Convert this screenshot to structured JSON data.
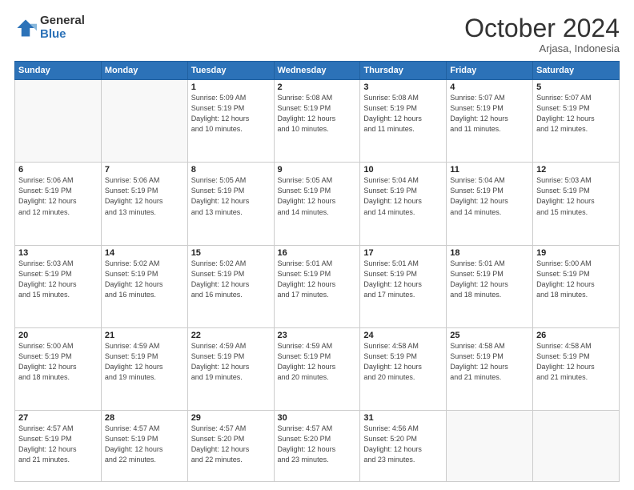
{
  "logo": {
    "general": "General",
    "blue": "Blue"
  },
  "title": "October 2024",
  "subtitle": "Arjasa, Indonesia",
  "days_of_week": [
    "Sunday",
    "Monday",
    "Tuesday",
    "Wednesday",
    "Thursday",
    "Friday",
    "Saturday"
  ],
  "weeks": [
    [
      {
        "day": "",
        "info": ""
      },
      {
        "day": "",
        "info": ""
      },
      {
        "day": "1",
        "info": "Sunrise: 5:09 AM\nSunset: 5:19 PM\nDaylight: 12 hours\nand 10 minutes."
      },
      {
        "day": "2",
        "info": "Sunrise: 5:08 AM\nSunset: 5:19 PM\nDaylight: 12 hours\nand 10 minutes."
      },
      {
        "day": "3",
        "info": "Sunrise: 5:08 AM\nSunset: 5:19 PM\nDaylight: 12 hours\nand 11 minutes."
      },
      {
        "day": "4",
        "info": "Sunrise: 5:07 AM\nSunset: 5:19 PM\nDaylight: 12 hours\nand 11 minutes."
      },
      {
        "day": "5",
        "info": "Sunrise: 5:07 AM\nSunset: 5:19 PM\nDaylight: 12 hours\nand 12 minutes."
      }
    ],
    [
      {
        "day": "6",
        "info": "Sunrise: 5:06 AM\nSunset: 5:19 PM\nDaylight: 12 hours\nand 12 minutes."
      },
      {
        "day": "7",
        "info": "Sunrise: 5:06 AM\nSunset: 5:19 PM\nDaylight: 12 hours\nand 13 minutes."
      },
      {
        "day": "8",
        "info": "Sunrise: 5:05 AM\nSunset: 5:19 PM\nDaylight: 12 hours\nand 13 minutes."
      },
      {
        "day": "9",
        "info": "Sunrise: 5:05 AM\nSunset: 5:19 PM\nDaylight: 12 hours\nand 14 minutes."
      },
      {
        "day": "10",
        "info": "Sunrise: 5:04 AM\nSunset: 5:19 PM\nDaylight: 12 hours\nand 14 minutes."
      },
      {
        "day": "11",
        "info": "Sunrise: 5:04 AM\nSunset: 5:19 PM\nDaylight: 12 hours\nand 14 minutes."
      },
      {
        "day": "12",
        "info": "Sunrise: 5:03 AM\nSunset: 5:19 PM\nDaylight: 12 hours\nand 15 minutes."
      }
    ],
    [
      {
        "day": "13",
        "info": "Sunrise: 5:03 AM\nSunset: 5:19 PM\nDaylight: 12 hours\nand 15 minutes."
      },
      {
        "day": "14",
        "info": "Sunrise: 5:02 AM\nSunset: 5:19 PM\nDaylight: 12 hours\nand 16 minutes."
      },
      {
        "day": "15",
        "info": "Sunrise: 5:02 AM\nSunset: 5:19 PM\nDaylight: 12 hours\nand 16 minutes."
      },
      {
        "day": "16",
        "info": "Sunrise: 5:01 AM\nSunset: 5:19 PM\nDaylight: 12 hours\nand 17 minutes."
      },
      {
        "day": "17",
        "info": "Sunrise: 5:01 AM\nSunset: 5:19 PM\nDaylight: 12 hours\nand 17 minutes."
      },
      {
        "day": "18",
        "info": "Sunrise: 5:01 AM\nSunset: 5:19 PM\nDaylight: 12 hours\nand 18 minutes."
      },
      {
        "day": "19",
        "info": "Sunrise: 5:00 AM\nSunset: 5:19 PM\nDaylight: 12 hours\nand 18 minutes."
      }
    ],
    [
      {
        "day": "20",
        "info": "Sunrise: 5:00 AM\nSunset: 5:19 PM\nDaylight: 12 hours\nand 18 minutes."
      },
      {
        "day": "21",
        "info": "Sunrise: 4:59 AM\nSunset: 5:19 PM\nDaylight: 12 hours\nand 19 minutes."
      },
      {
        "day": "22",
        "info": "Sunrise: 4:59 AM\nSunset: 5:19 PM\nDaylight: 12 hours\nand 19 minutes."
      },
      {
        "day": "23",
        "info": "Sunrise: 4:59 AM\nSunset: 5:19 PM\nDaylight: 12 hours\nand 20 minutes."
      },
      {
        "day": "24",
        "info": "Sunrise: 4:58 AM\nSunset: 5:19 PM\nDaylight: 12 hours\nand 20 minutes."
      },
      {
        "day": "25",
        "info": "Sunrise: 4:58 AM\nSunset: 5:19 PM\nDaylight: 12 hours\nand 21 minutes."
      },
      {
        "day": "26",
        "info": "Sunrise: 4:58 AM\nSunset: 5:19 PM\nDaylight: 12 hours\nand 21 minutes."
      }
    ],
    [
      {
        "day": "27",
        "info": "Sunrise: 4:57 AM\nSunset: 5:19 PM\nDaylight: 12 hours\nand 21 minutes."
      },
      {
        "day": "28",
        "info": "Sunrise: 4:57 AM\nSunset: 5:19 PM\nDaylight: 12 hours\nand 22 minutes."
      },
      {
        "day": "29",
        "info": "Sunrise: 4:57 AM\nSunset: 5:20 PM\nDaylight: 12 hours\nand 22 minutes."
      },
      {
        "day": "30",
        "info": "Sunrise: 4:57 AM\nSunset: 5:20 PM\nDaylight: 12 hours\nand 23 minutes."
      },
      {
        "day": "31",
        "info": "Sunrise: 4:56 AM\nSunset: 5:20 PM\nDaylight: 12 hours\nand 23 minutes."
      },
      {
        "day": "",
        "info": ""
      },
      {
        "day": "",
        "info": ""
      }
    ]
  ]
}
